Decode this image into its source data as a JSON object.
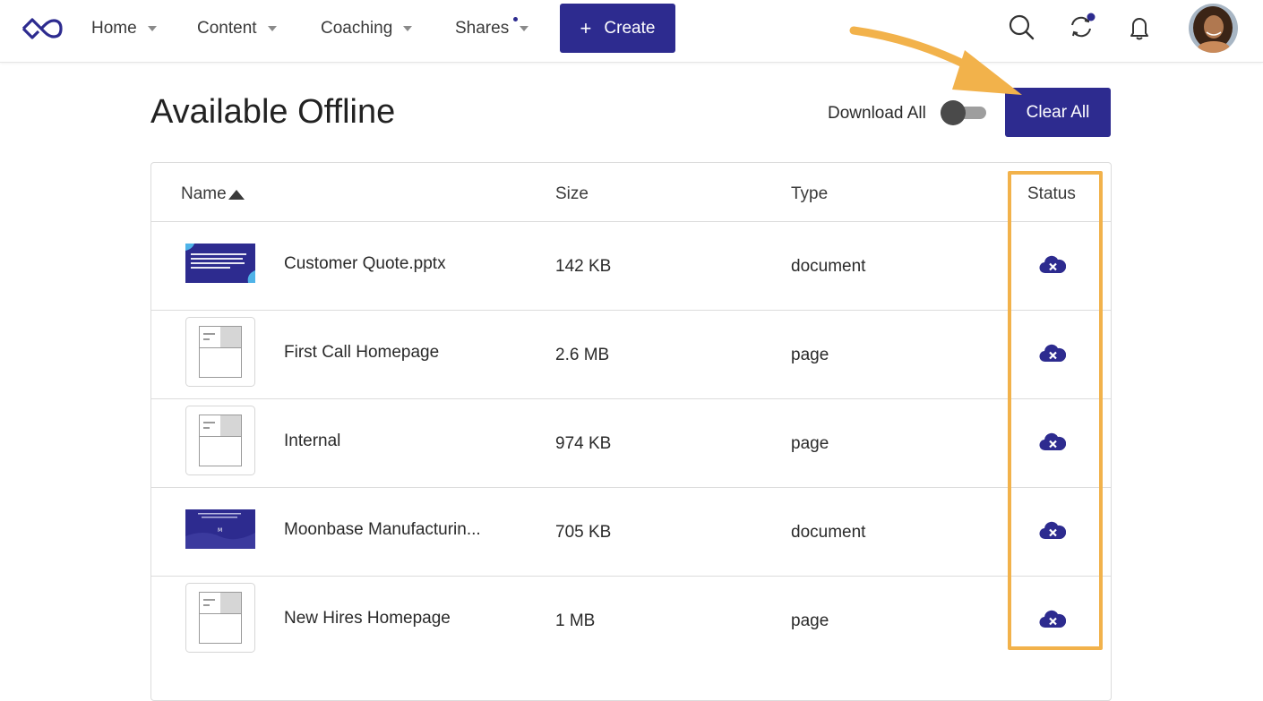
{
  "nav": {
    "items": [
      {
        "label": "Home"
      },
      {
        "label": "Content"
      },
      {
        "label": "Coaching"
      },
      {
        "label": "Shares"
      }
    ],
    "create_label": "Create",
    "icons": [
      "search-icon",
      "sync-icon",
      "bell-icon"
    ]
  },
  "page": {
    "title": "Available Offline",
    "download_all_label": "Download All",
    "download_all_enabled": false,
    "clear_all_label": "Clear All"
  },
  "table": {
    "headers": {
      "name": "Name",
      "size": "Size",
      "type": "Type",
      "status": "Status"
    },
    "sort": {
      "column": "Name",
      "direction": "ascending"
    },
    "rows": [
      {
        "name": "Customer Quote.pptx",
        "size": "142 KB",
        "type": "document",
        "thumb": "slide-thumbnail",
        "status": "cloud-remove-icon"
      },
      {
        "name": "First Call Homepage",
        "size": "2.6 MB",
        "type": "page",
        "thumb": "page-thumbnail",
        "status": "cloud-remove-icon"
      },
      {
        "name": "Internal",
        "size": "974 KB",
        "type": "page",
        "thumb": "page-thumbnail",
        "status": "cloud-remove-icon"
      },
      {
        "name": "Moonbase Manufacturin...",
        "size": "705 KB",
        "type": "document",
        "thumb": "slide-thumbnail",
        "status": "cloud-remove-icon"
      },
      {
        "name": "New Hires Homepage",
        "size": "1 MB",
        "type": "page",
        "thumb": "page-thumbnail",
        "status": "cloud-remove-icon"
      }
    ]
  },
  "colors": {
    "accent": "#2d2b8f",
    "highlight": "#f2b24b",
    "border": "#dcdcdc"
  }
}
